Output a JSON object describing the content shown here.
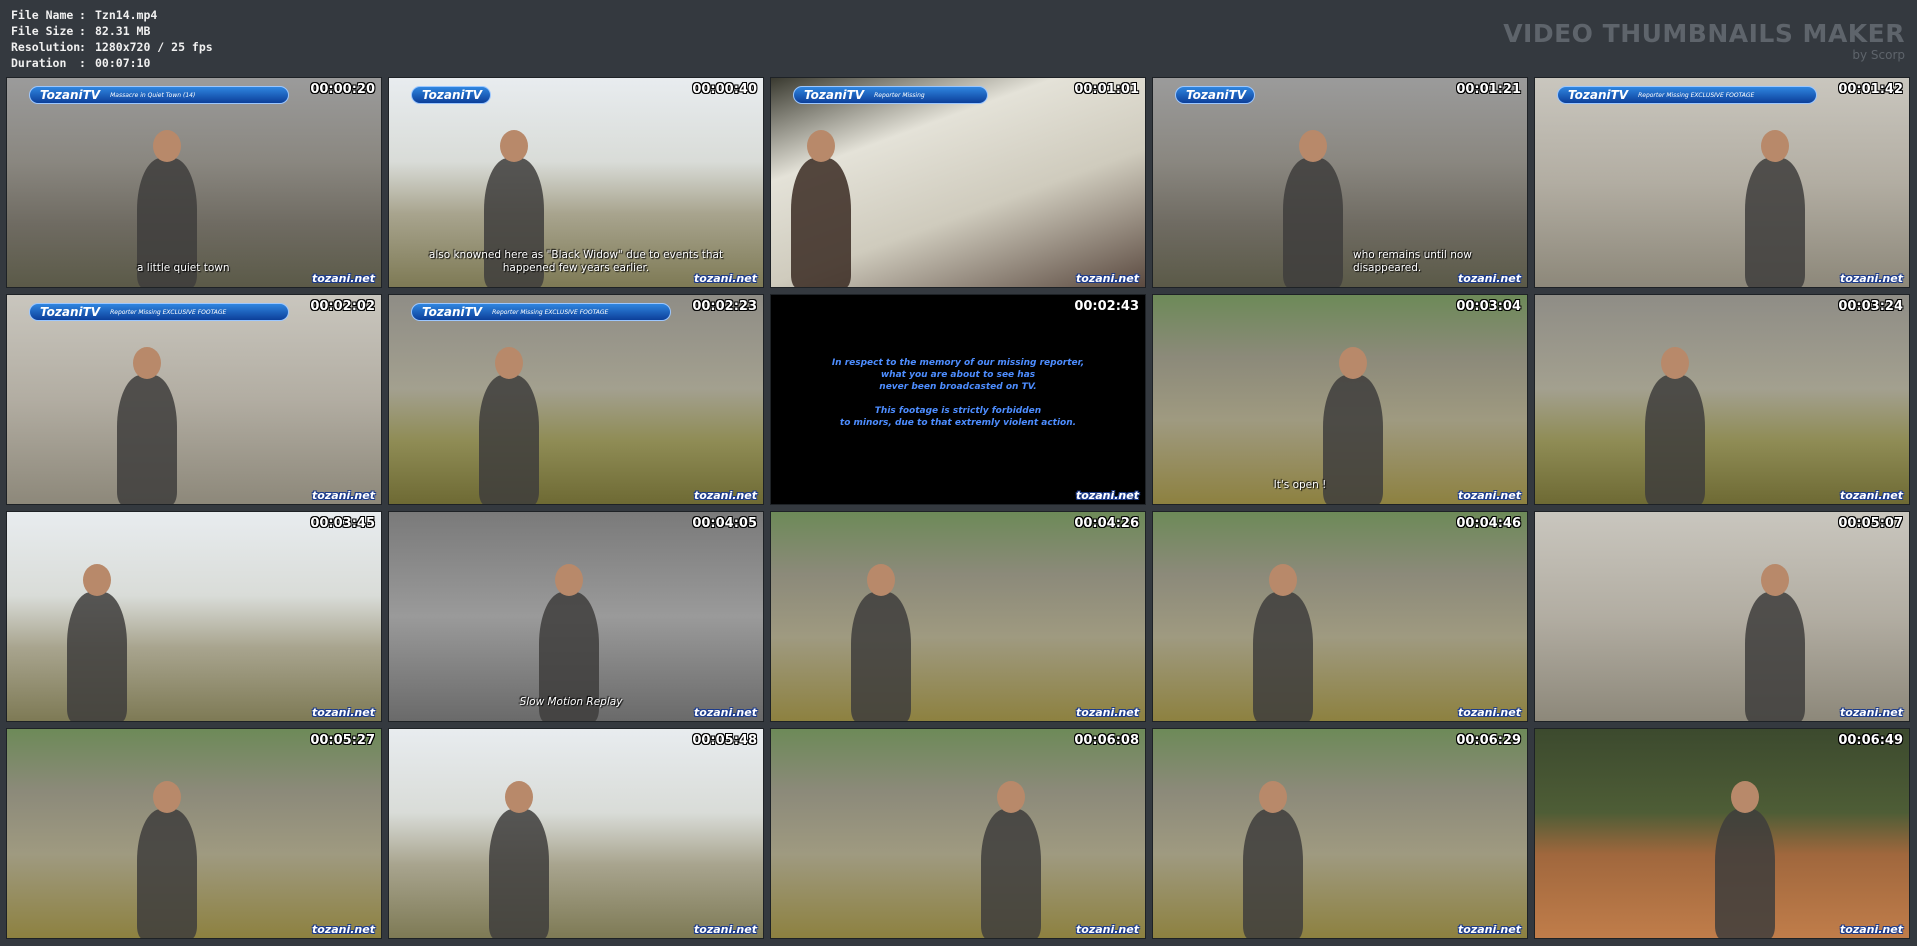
{
  "header": {
    "file_name_key": "File Name",
    "file_name_val": "Tzn14.mp4",
    "file_size_key": "File Size",
    "file_size_val": "82.31 MB",
    "resolution_key": "Resolution",
    "resolution_val": "1280x720 / 25 fps",
    "duration_key": "Duration",
    "duration_val": "00:07:10",
    "separator": ":",
    "brand_title": "VIDEO THUMBNAILS MAKER",
    "brand_sub": "by Scorp"
  },
  "logo_text": "TozaniTV",
  "watermark": "tozani.net",
  "thumbnails": [
    {
      "time": "00:00:20",
      "subtitle": "a little quiet town",
      "scene": "s-wall",
      "logo": "wide",
      "logo_sub": "Massacre in Quiet Town (14)"
    },
    {
      "time": "00:00:40",
      "subtitle": "also knowned here as \"Black Widow\" due to events that happened few years earlier.",
      "scene": "s-sky",
      "logo": "short",
      "logo_sub": ""
    },
    {
      "time": "00:01:01",
      "subtitle": "",
      "scene": "s-bed",
      "logo": "mid",
      "logo_sub": "Reporter Missing"
    },
    {
      "time": "00:01:21",
      "subtitle": "who remains until now disappeared.",
      "scene": "s-wall",
      "logo": "short",
      "logo_sub": ""
    },
    {
      "time": "00:01:42",
      "subtitle": "",
      "scene": "s-wall2",
      "logo": "wide",
      "logo_sub": "Reporter Missing EXCLUSIVE FOOTAGE"
    },
    {
      "time": "00:02:02",
      "subtitle": "",
      "scene": "s-wall2",
      "logo": "wide",
      "logo_sub": "Reporter Missing EXCLUSIVE FOOTAGE"
    },
    {
      "time": "00:02:23",
      "subtitle": "",
      "scene": "s-grass",
      "logo": "wide",
      "logo_sub": "Reporter Missing EXCLUSIVE FOOTAGE"
    },
    {
      "time": "00:02:43",
      "subtitle": "",
      "scene": "s-black",
      "logo": "",
      "logo_sub": ""
    },
    {
      "time": "00:03:04",
      "subtitle": "It's open !",
      "scene": "s-yard",
      "logo": "",
      "logo_sub": ""
    },
    {
      "time": "00:03:24",
      "subtitle": "",
      "scene": "s-grass",
      "logo": "",
      "logo_sub": ""
    },
    {
      "time": "00:03:45",
      "subtitle": "",
      "scene": "s-sky",
      "logo": "",
      "logo_sub": ""
    },
    {
      "time": "00:04:05",
      "subtitle": "Slow Motion Replay",
      "scene": "s-gray",
      "logo": "",
      "logo_sub": ""
    },
    {
      "time": "00:04:26",
      "subtitle": "",
      "scene": "s-yard",
      "logo": "",
      "logo_sub": ""
    },
    {
      "time": "00:04:46",
      "subtitle": "",
      "scene": "s-yard",
      "logo": "",
      "logo_sub": ""
    },
    {
      "time": "00:05:07",
      "subtitle": "",
      "scene": "s-wall2",
      "logo": "",
      "logo_sub": ""
    },
    {
      "time": "00:05:27",
      "subtitle": "",
      "scene": "s-yard",
      "logo": "",
      "logo_sub": ""
    },
    {
      "time": "00:05:48",
      "subtitle": "",
      "scene": "s-sky",
      "logo": "",
      "logo_sub": ""
    },
    {
      "time": "00:06:08",
      "subtitle": "",
      "scene": "s-yard",
      "logo": "",
      "logo_sub": ""
    },
    {
      "time": "00:06:29",
      "subtitle": "",
      "scene": "s-yard",
      "logo": "",
      "logo_sub": ""
    },
    {
      "time": "00:06:49",
      "subtitle": "",
      "scene": "s-wood",
      "logo": "",
      "logo_sub": ""
    }
  ],
  "notice": {
    "line1": "In respect to the memory of our missing reporter,",
    "line2": "what you are about to see has",
    "line3": "never been broadcasted on TV.",
    "line4": "This footage is strictly forbidden",
    "line5": "to minors, due to that extremly violent action."
  }
}
